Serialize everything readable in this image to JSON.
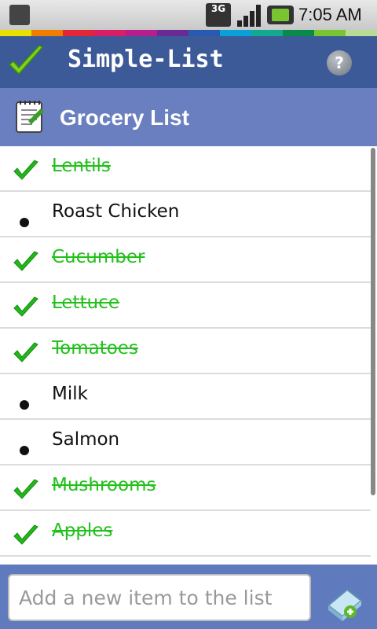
{
  "status_bar": {
    "network_label": "3G",
    "time": "7:05 AM",
    "icons": [
      "sim-card-icon",
      "network-3g-icon",
      "signal-strength-icon",
      "battery-icon"
    ]
  },
  "rainbow_colors": [
    "#e8e000",
    "#f07c00",
    "#e22638",
    "#d81e64",
    "#b61e8c",
    "#6a2a95",
    "#2a5ab0",
    "#0aa0d8",
    "#14a890",
    "#0a8a4a",
    "#78c531",
    "#b8dc96"
  ],
  "app_header": {
    "title": "Simple-List",
    "help_label": "?",
    "icons": [
      "check-logo-icon",
      "help-icon"
    ]
  },
  "list_header": {
    "title": "Grocery List",
    "icon": "notepad-icon"
  },
  "colors": {
    "header_blue": "#3d5a98",
    "subheader_blue": "#6a7fbf",
    "done_green": "#22c01b"
  },
  "items": [
    {
      "label": "Lentils",
      "done": true
    },
    {
      "label": "Roast Chicken",
      "done": false
    },
    {
      "label": "Cucumber",
      "done": true
    },
    {
      "label": "Lettuce",
      "done": true
    },
    {
      "label": "Tomatoes",
      "done": true
    },
    {
      "label": "Milk",
      "done": false
    },
    {
      "label": "Salmon",
      "done": false
    },
    {
      "label": "Mushrooms",
      "done": true
    },
    {
      "label": "Apples",
      "done": true
    }
  ],
  "new_item": {
    "value": "",
    "placeholder": "Add a new item to the list",
    "add_icon": "add-item-icon"
  }
}
